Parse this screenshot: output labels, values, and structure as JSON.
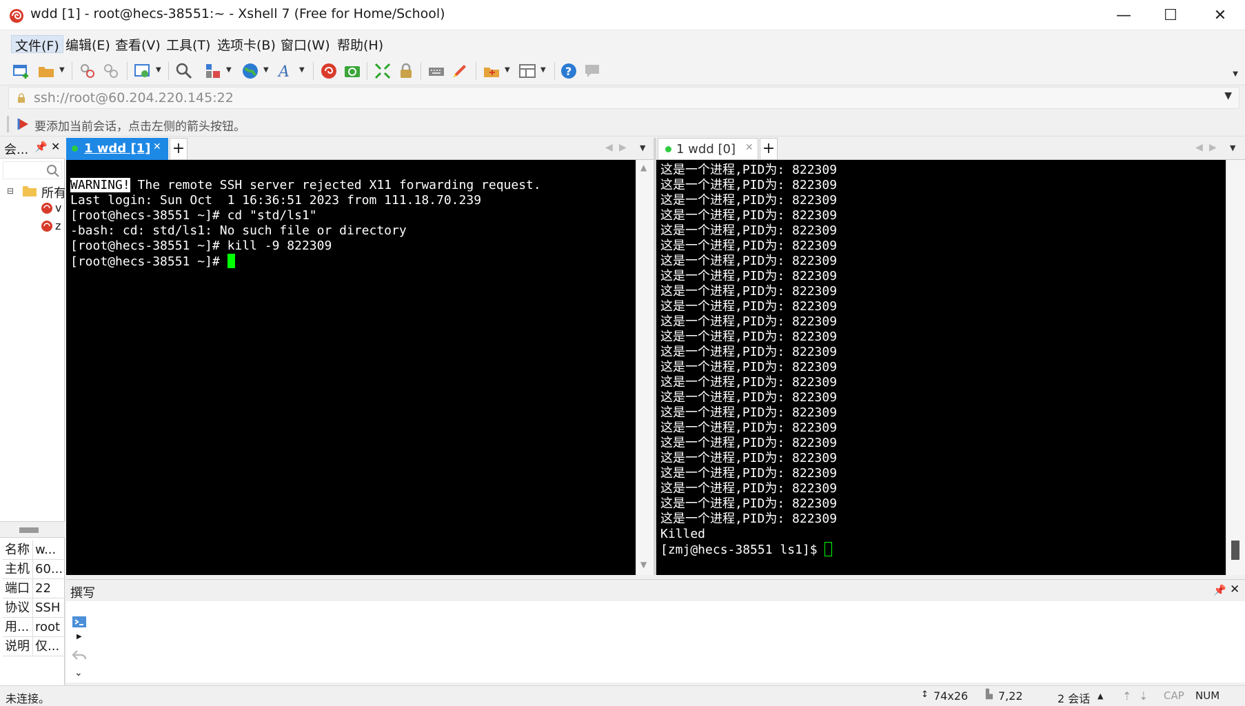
{
  "window": {
    "title": "wdd [1] - root@hecs-38551:~ - Xshell 7 (Free for Home/School)",
    "minimize": "—",
    "maximize": "☐",
    "close": "✕"
  },
  "menu": [
    "文件(F)",
    "编辑(E)",
    "查看(V)",
    "工具(T)",
    "选项卡(B)",
    "窗口(W)",
    "帮助(H)"
  ],
  "toolbar_icons": [
    "new-session-icon",
    "open-folder-icon",
    "reconnect-icon",
    "disconnect-icon",
    "properties-icon",
    "find-icon",
    "layout-icon",
    "globe-icon",
    "font-icon",
    "xshell-icon",
    "xftp-icon",
    "fullscreen-icon",
    "lock-icon",
    "keyboard-icon",
    "highlight-icon",
    "transfer-icon",
    "split-layout-icon",
    "help-icon",
    "chat-icon"
  ],
  "address": {
    "url": "ssh://root@60.204.220.145:22"
  },
  "hint": "要添加当前会话，点击左侧的箭头按钮。",
  "left_panel": {
    "header_label": "会...",
    "tree_root": "所有",
    "tree_items": [
      "v",
      "z"
    ],
    "properties": [
      {
        "key": "名称",
        "value": "w..."
      },
      {
        "key": "主机",
        "value": "60...."
      },
      {
        "key": "端口",
        "value": "22"
      },
      {
        "key": "协议",
        "value": "SSH"
      },
      {
        "key": "用...",
        "value": "root"
      },
      {
        "key": "说明",
        "value": "仅..."
      }
    ]
  },
  "left_terminal": {
    "tab_label": "1 wdd [1]",
    "tab_add": "+",
    "warning_tag": "WARNING!",
    "lines": [
      " The remote SSH server rejected X11 forwarding request.",
      "Last login: Sun Oct  1 16:36:51 2023 from 111.18.70.239",
      "[root@hecs-38551 ~]# cd \"std/ls1\"",
      "-bash: cd: std/ls1: No such file or directory",
      "[root@hecs-38551 ~]# kill -9 822309",
      "[root@hecs-38551 ~]# "
    ]
  },
  "right_terminal": {
    "tab_label": "1 wdd [0]",
    "tab_add": "+",
    "lines": [
      "这是一个进程,PID为: 822309",
      "这是一个进程,PID为: 822309",
      "这是一个进程,PID为: 822309",
      "这是一个进程,PID为: 822309",
      "这是一个进程,PID为: 822309",
      "这是一个进程,PID为: 822309",
      "这是一个进程,PID为: 822309",
      "这是一个进程,PID为: 822309",
      "这是一个进程,PID为: 822309",
      "这是一个进程,PID为: 822309",
      "这是一个进程,PID为: 822309",
      "这是一个进程,PID为: 822309",
      "这是一个进程,PID为: 822309",
      "这是一个进程,PID为: 822309",
      "这是一个进程,PID为: 822309",
      "这是一个进程,PID为: 822309",
      "这是一个进程,PID为: 822309",
      "这是一个进程,PID为: 822309",
      "这是一个进程,PID为: 822309",
      "这是一个进程,PID为: 822309",
      "这是一个进程,PID为: 822309",
      "这是一个进程,PID为: 822309",
      "这是一个进程,PID为: 822309",
      "这是一个进程,PID为: 822309",
      "Killed",
      "[zmj@hecs-38551 ls1]$ "
    ]
  },
  "compose": {
    "label": "撰写"
  },
  "status": {
    "left": "未连接。",
    "size": "74x26",
    "cursor_pos": "7,22",
    "sessions": "2 会话",
    "caps": "CAP",
    "num": "NUM"
  },
  "colors": {
    "cursor": "#00ff00",
    "tab_active": "#1e88e5",
    "terminal_bg": "#000000"
  }
}
